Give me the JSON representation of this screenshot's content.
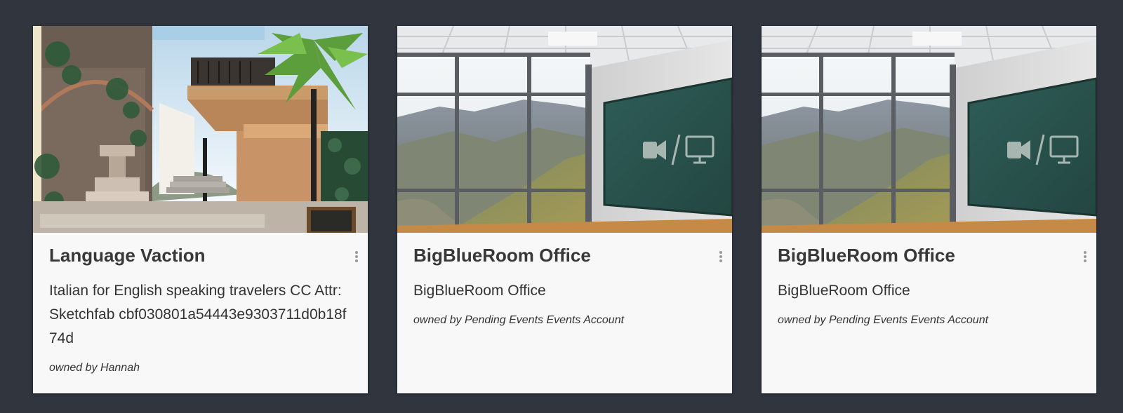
{
  "rooms": [
    {
      "title": "Language Vaction",
      "description": "Italian for English speaking travelers CC Attr: Sketchfab cbf030801a54443e9303711d0b18f74d",
      "owner": "owned by Hannah",
      "thumbnail_scene": "italian-town-plaza"
    },
    {
      "title": "BigBlueRoom Office",
      "description": "BigBlueRoom Office",
      "owner": "owned by Pending Events Events Account",
      "thumbnail_scene": "office-with-mountain-window"
    },
    {
      "title": "BigBlueRoom Office",
      "description": "BigBlueRoom Office",
      "owner": "owned by Pending Events Events Account",
      "thumbnail_scene": "office-with-mountain-window"
    }
  ],
  "icons": {
    "menu": "more-vertical-icon",
    "camera": "video-camera-icon",
    "screen": "monitor-icon"
  },
  "colors": {
    "page_background": "#30353e",
    "card_background": "#f8f8f8",
    "board_green": "#2c5a54"
  }
}
